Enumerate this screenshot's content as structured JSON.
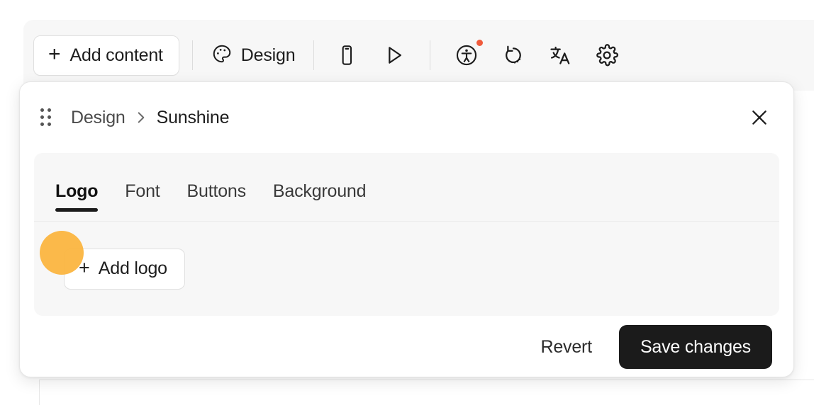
{
  "toolbar": {
    "add_content_label": "Add content",
    "add_content_icon": "plus-icon",
    "design_label": "Design",
    "design_icon": "palette-icon",
    "icons": [
      {
        "name": "mobile-preview-icon",
        "label": "Mobile preview"
      },
      {
        "name": "play-preview-icon",
        "label": "Preview"
      },
      {
        "name": "accessibility-icon",
        "label": "Accessibility",
        "badge": true
      },
      {
        "name": "undo-history-icon",
        "label": "Version history"
      },
      {
        "name": "translate-icon",
        "label": "Translate"
      },
      {
        "name": "gear-icon",
        "label": "Settings"
      }
    ]
  },
  "panel": {
    "drag_handle_icon": "drag-handle-icon",
    "breadcrumb": {
      "parent": "Design",
      "separator": "›",
      "current": "Sunshine"
    },
    "close_icon": "close-icon",
    "tabs": [
      {
        "label": "Logo",
        "active": true
      },
      {
        "label": "Font",
        "active": false
      },
      {
        "label": "Buttons",
        "active": false
      },
      {
        "label": "Background",
        "active": false
      }
    ],
    "content": {
      "add_logo_label": "Add logo",
      "add_logo_icon": "plus-icon"
    },
    "footer": {
      "revert_label": "Revert",
      "save_label": "Save changes"
    }
  },
  "colors": {
    "accent": "#1b1b1b",
    "cursor": "#fbb540",
    "notification": "#f05b3c",
    "panel_bg": "#ffffff",
    "surface": "#f7f7f7"
  }
}
